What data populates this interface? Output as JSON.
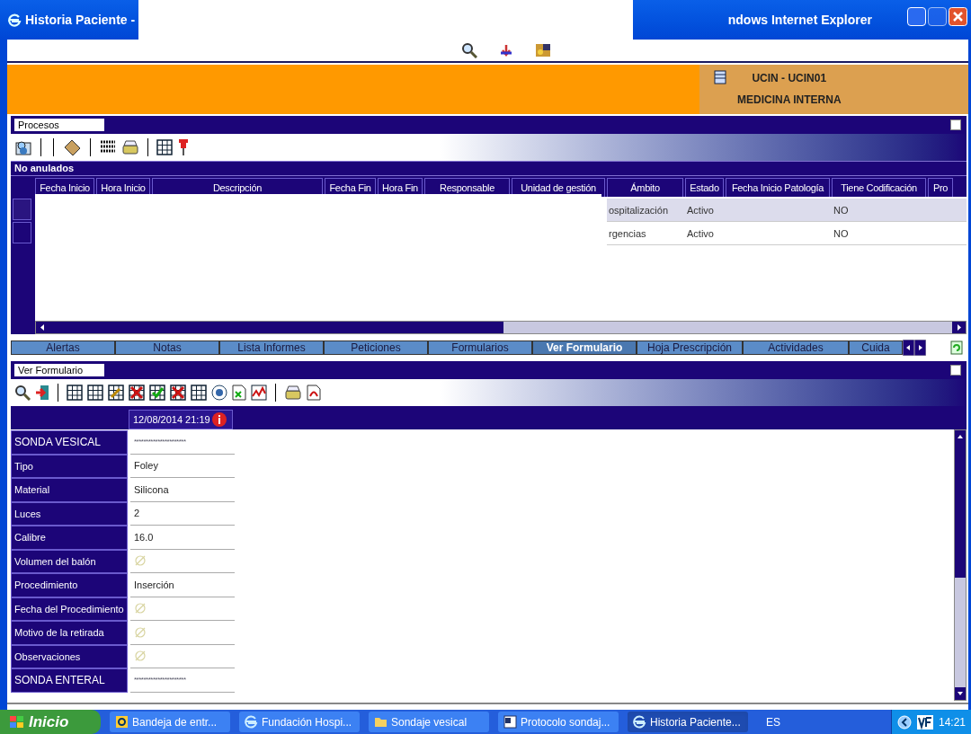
{
  "window": {
    "title_left": "Historia Paciente -",
    "title_right": "ndows Internet Explorer"
  },
  "banner": {
    "unit": "UCIN - UCIN01",
    "service": "MEDICINA INTERNA"
  },
  "procesos": {
    "title": "Procesos",
    "section": "No anulados",
    "table": {
      "columns": [
        "Fecha Inicio",
        "Hora Inicio",
        "Descripción",
        "Fecha Fin",
        "Hora Fin",
        "Responsable",
        "Unidad de gestión",
        "Ámbito",
        "Estado",
        "Fecha Inicio Patología",
        "Tiene Codificación",
        "Pro"
      ],
      "rows": [
        {
          "ambito": "ospitalización",
          "estado": "Activo",
          "codificacion": "NO",
          "selected": true
        },
        {
          "ambito": "rgencias",
          "estado": "Activo",
          "codificacion": "NO",
          "selected": false
        }
      ]
    }
  },
  "tabs": [
    {
      "label": "Alertas",
      "selected": false
    },
    {
      "label": "Notas",
      "selected": false
    },
    {
      "label": "Lista Informes",
      "selected": false
    },
    {
      "label": "Peticiones",
      "selected": false
    },
    {
      "label": "Formularios",
      "selected": false
    },
    {
      "label": "Ver Formulario",
      "selected": true
    },
    {
      "label": "Hoja Prescripción",
      "selected": false
    },
    {
      "label": "Actividades",
      "selected": false
    },
    {
      "label": "Cuida",
      "selected": false
    }
  ],
  "form": {
    "title": "Ver Formulario",
    "date": "12/08/2014 21:19",
    "rows": [
      {
        "label": "SONDA VESICAL",
        "kind": "section",
        "value": "**********************"
      },
      {
        "label": "Tipo",
        "kind": "value",
        "value": "Foley"
      },
      {
        "label": "Material",
        "kind": "value",
        "value": "Silicona"
      },
      {
        "label": "Luces",
        "kind": "value",
        "value": "2"
      },
      {
        "label": "Calibre",
        "kind": "value",
        "value": "16.0"
      },
      {
        "label": "Volumen del balón",
        "kind": "empty"
      },
      {
        "label": "Procedimiento",
        "kind": "value",
        "value": "Inserción"
      },
      {
        "label": "Fecha del Procedimiento",
        "kind": "empty"
      },
      {
        "label": "Motivo de la retirada",
        "kind": "empty"
      },
      {
        "label": "Observaciones",
        "kind": "empty"
      },
      {
        "label": "SONDA ENTERAL",
        "kind": "section",
        "value": "**********************"
      }
    ]
  },
  "taskbar": {
    "start": "Inicio",
    "items": [
      {
        "label": "Bandeja de entr...",
        "selected": false
      },
      {
        "label": "Fundación Hospi...",
        "selected": false
      },
      {
        "label": "Sondaje vesical",
        "selected": false
      },
      {
        "label": "Protocolo sondaj...",
        "selected": false
      },
      {
        "label": "Historia Paciente...",
        "selected": true
      }
    ],
    "language": "ES",
    "clock": "14:21"
  }
}
